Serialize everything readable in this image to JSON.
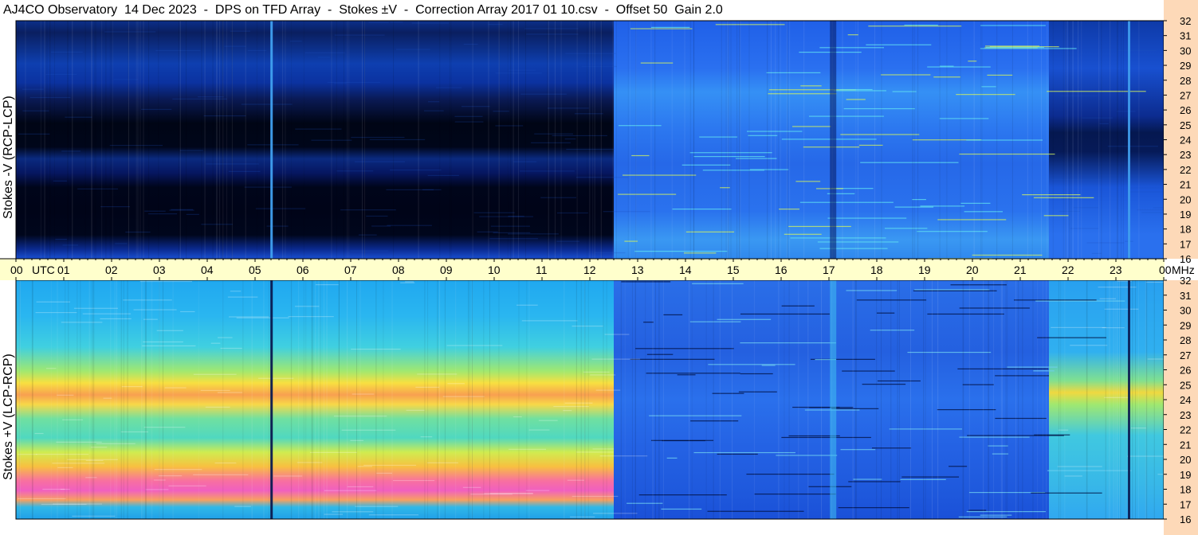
{
  "title": "AJ4CO Observatory  14 Dec 2023  -  DPS on TFD Array  -  Stokes ±V  -  Correction Array 2017 01 10.csv  -  Offset 50  Gain 2.0",
  "colors": {
    "background": "#ffffff",
    "time_axis_band": "#ffffcc",
    "freq_axis_band": "#fdd9b8",
    "border": "#000000"
  },
  "chart_data": [
    {
      "type": "heatmap",
      "title": "",
      "panel": "top",
      "ylabel": "Stokes -V (RCP-LCP)",
      "x_unit": "UTC",
      "y_unit": "MHz",
      "xlim": [
        0,
        24
      ],
      "ylim": [
        16,
        32
      ],
      "x_ticks": [
        "00",
        "01",
        "02",
        "03",
        "04",
        "05",
        "06",
        "07",
        "08",
        "09",
        "10",
        "11",
        "12",
        "13",
        "14",
        "15",
        "16",
        "17",
        "18",
        "19",
        "20",
        "21",
        "22",
        "23",
        "00"
      ],
      "y_ticks": [
        "16",
        "17",
        "18",
        "19",
        "20",
        "21",
        "22",
        "23",
        "24",
        "25",
        "26",
        "27",
        "28",
        "29",
        "30",
        "31",
        "32"
      ],
      "colormap": "jet",
      "description_segments": [
        {
          "utc_from": 0,
          "utc_to": 12.5,
          "level": "very low (dark blue/black), dark band 18-25 MHz"
        },
        {
          "utc_from": 12.5,
          "utc_to": 21.6,
          "level": "moderate (blue/cyan) with RFI lines"
        },
        {
          "utc_from": 21.6,
          "utc_to": 24,
          "level": "low (dark blue), dark band 23-25 MHz"
        }
      ]
    },
    {
      "type": "heatmap",
      "title": "",
      "panel": "bottom",
      "ylabel": "Stokes +V (LCP-RCP)",
      "x_unit": "UTC",
      "y_unit": "MHz",
      "xlim": [
        0,
        24
      ],
      "ylim": [
        16,
        32
      ],
      "x_ticks": [
        "00",
        "01",
        "02",
        "03",
        "04",
        "05",
        "06",
        "07",
        "08",
        "09",
        "10",
        "11",
        "12",
        "13",
        "14",
        "15",
        "16",
        "17",
        "18",
        "19",
        "20",
        "21",
        "22",
        "23",
        "00"
      ],
      "y_ticks": [
        "16",
        "17",
        "18",
        "19",
        "20",
        "21",
        "22",
        "23",
        "24",
        "25",
        "26",
        "27",
        "28",
        "29",
        "30",
        "31",
        "32"
      ],
      "colormap": "jet",
      "description_segments": [
        {
          "utc_from": 0,
          "utc_to": 12.5,
          "level": "high (yellow/orange/magenta), peaks 17.5-18.5 MHz and 24-25 MHz"
        },
        {
          "utc_from": 12.5,
          "utc_to": 21.6,
          "level": "moderate (blue) with dark RFI lines"
        },
        {
          "utc_from": 21.6,
          "utc_to": 24,
          "level": "moderate-high (cyan/yellow) near 24 MHz"
        }
      ]
    }
  ],
  "time_axis": {
    "labels": [
      "00",
      "01",
      "02",
      "03",
      "04",
      "05",
      "06",
      "07",
      "08",
      "09",
      "10",
      "11",
      "12",
      "13",
      "14",
      "15",
      "16",
      "17",
      "18",
      "19",
      "20",
      "21",
      "22",
      "23",
      "00"
    ],
    "utc_label": "UTC",
    "mhz_label": "MHz"
  }
}
